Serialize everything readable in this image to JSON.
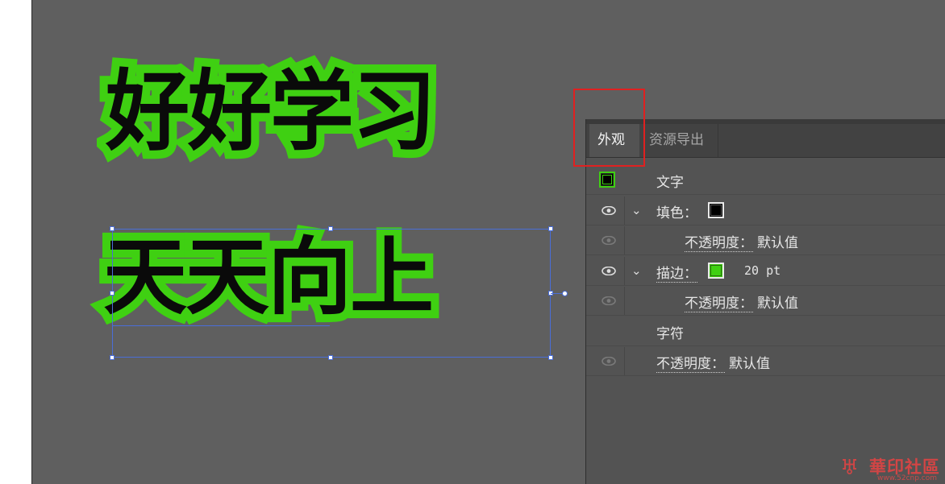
{
  "canvas": {
    "art_line1": "好好学习",
    "art_line2": "天天向上",
    "stroke_color": "#3fd012",
    "fill_color": "#0a0a0a"
  },
  "panel": {
    "tabs": [
      {
        "label": "外观"
      },
      {
        "label": "资源导出"
      }
    ],
    "header_label": "文字",
    "fill_label": "填色：",
    "fill_opacity_label": "不透明度：",
    "fill_opacity_value": "默认值",
    "stroke_label": "描边：",
    "stroke_width": "20 pt",
    "stroke_opacity_label": "不透明度：",
    "stroke_opacity_value": "默认值",
    "chars_label": "字符",
    "opacity_label": "不透明度：",
    "opacity_value": "默认值",
    "colors": {
      "fill_swatch": "#000000",
      "stroke_swatch": "#3fd012",
      "highlight": "#e02020"
    }
  },
  "watermark": {
    "text": "華印社區",
    "url": "www.52cnp.com"
  }
}
